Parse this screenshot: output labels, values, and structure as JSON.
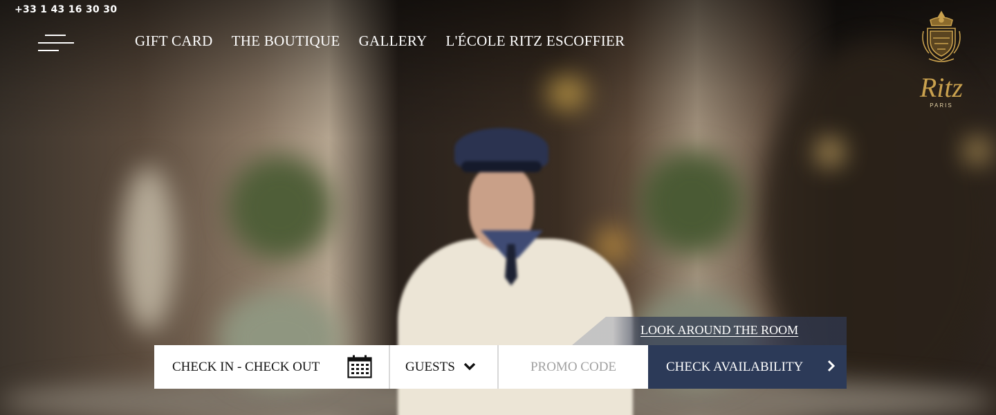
{
  "header": {
    "phone": "+33 1 43 16 30 30",
    "menu_icon": "hamburger-menu-icon",
    "nav": [
      {
        "label": "GIFT CARD"
      },
      {
        "label": "THE BOUTIQUE"
      },
      {
        "label": "GALLERY"
      },
      {
        "label": "L'ÉCOLE RITZ ESCOFFIER"
      }
    ],
    "logo": {
      "wordmark": "Ritz",
      "city": "PARIS",
      "color": "#c9a14e"
    }
  },
  "hero": {
    "look_around": "LOOK AROUND THE ROOM"
  },
  "booking": {
    "dates_label": "CHECK IN - CHECK OUT",
    "dates_icon": "calendar-icon",
    "guests_label": "GUESTS",
    "guests_icon": "chevron-down-icon",
    "promo_placeholder": "PROMO CODE",
    "check_label": "CHECK AVAILABILITY",
    "check_icon": "chevron-right-icon",
    "check_bg": "#2c3a58"
  }
}
